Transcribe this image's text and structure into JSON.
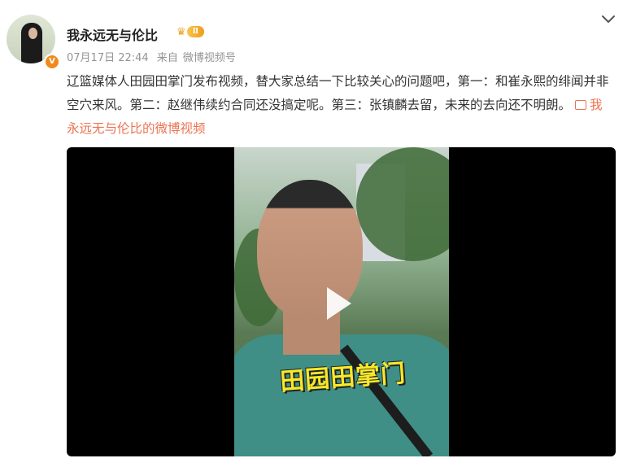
{
  "post": {
    "username": "我永远无与伦比",
    "level_badge": "Ⅱ",
    "verified_badge": "V",
    "date": "07月17日 22:44",
    "source_prefix": "来自",
    "source": "微博视频号",
    "body_text": "辽篮媒体人田园田掌门发布视频，替大家总结一下比较关心的问题吧，第一：和崔永熙的绯闻并非空穴来风。第二：赵继伟续约合同还没搞定呢。第三：张镇麟去留，未来的去向还不明朗。",
    "video_link_text": "我永远无与伦比的微博视频"
  },
  "video": {
    "caption": "田园田掌门",
    "play_icon": "play-icon"
  },
  "colors": {
    "link": "#eb7350",
    "meta": "#939393",
    "verified": "#f08a1c",
    "caption": "#f6e82a"
  }
}
